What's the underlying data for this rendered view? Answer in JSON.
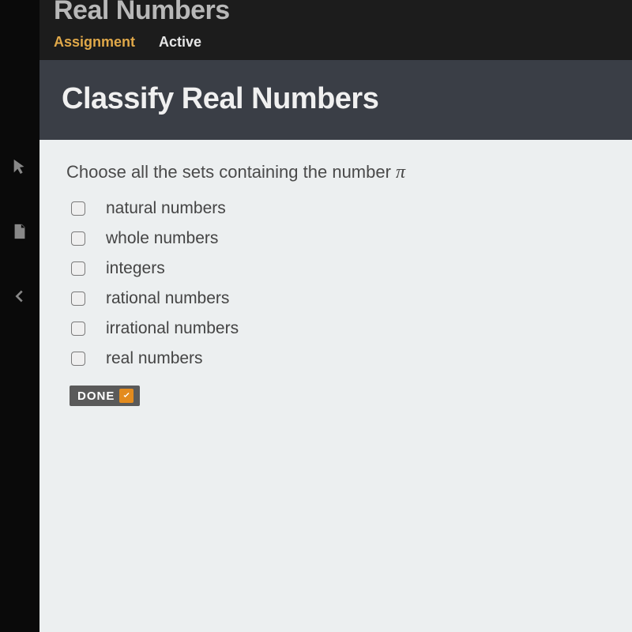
{
  "topbar": {
    "title": "Real Numbers",
    "tabs": [
      {
        "label": "Assignment",
        "active": true
      },
      {
        "label": "Active",
        "active": false
      }
    ]
  },
  "header": {
    "title": "Classify Real Numbers"
  },
  "question": {
    "prompt_prefix": "Choose all the sets containing the number ",
    "symbol": "π",
    "options": [
      {
        "label": "natural numbers",
        "checked": false
      },
      {
        "label": "whole numbers",
        "checked": false
      },
      {
        "label": "integers",
        "checked": false
      },
      {
        "label": "rational numbers",
        "checked": false
      },
      {
        "label": "irrational numbers",
        "checked": false
      },
      {
        "label": "real numbers",
        "checked": false
      }
    ],
    "done_label": "DONE"
  },
  "colors": {
    "accent_orange": "#e38b1e",
    "tab_active": "#e0a849",
    "header_band": "#3a3e46",
    "content_bg": "#eceff0"
  }
}
